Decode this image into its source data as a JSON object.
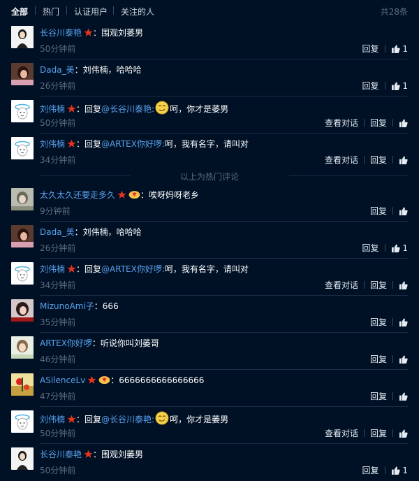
{
  "tabs": [
    {
      "label": "全部",
      "active": true
    },
    {
      "label": "热门",
      "active": false
    },
    {
      "label": "认证用户",
      "active": false
    },
    {
      "label": "关注的人",
      "active": false
    }
  ],
  "total": "共28条",
  "divider": "以上为热门评论",
  "comments": [
    {
      "name": "长谷川泰艳",
      "badge": "star",
      "pre": "：",
      "mention": "",
      "emoji": "",
      "body": "围观刘萎男",
      "time": "50分钟前",
      "reply": "回复",
      "dialog": "",
      "likes": "1",
      "avatar": "girl-white"
    },
    {
      "name": "Dada_美",
      "badge": "",
      "pre": "：",
      "mention": "",
      "emoji": "",
      "body": "刘伟楠，哈哈哈",
      "time": "26分钟前",
      "reply": "回复",
      "dialog": "",
      "likes": "1",
      "avatar": "girl-dark"
    },
    {
      "name": "刘伟楠",
      "badge": "star",
      "pre": "：回复",
      "mention": "@长谷川泰艳:",
      "emoji": "smile",
      "body": "呵，你才是萎男",
      "time": "50分钟前",
      "reply": "回复",
      "dialog": "查看对话",
      "likes": "",
      "avatar": "egg"
    },
    {
      "name": "刘伟楠",
      "badge": "star",
      "pre": "：回复",
      "mention": "@ARTEX你好啰:",
      "emoji": "",
      "body": "呵，我有名字，请叫对",
      "time": "34分钟前",
      "reply": "回复",
      "dialog": "查看对话",
      "likes": "",
      "avatar": "egg"
    },
    {
      "name": "太久太久还要走多久",
      "badge": "star2",
      "pre": "：",
      "mention": "",
      "emoji": "",
      "body": "唉呀妈呀老乡",
      "time": "9分钟前",
      "reply": "回复",
      "dialog": "",
      "likes": "",
      "avatar": "girl-gray"
    },
    {
      "name": "Dada_美",
      "badge": "",
      "pre": "：",
      "mention": "",
      "emoji": "",
      "body": "刘伟楠，哈哈哈",
      "time": "26分钟前",
      "reply": "回复",
      "dialog": "",
      "likes": "1",
      "avatar": "girl-dark"
    },
    {
      "name": "刘伟楠",
      "badge": "star",
      "pre": "：回复",
      "mention": "@ARTEX你好啰:",
      "emoji": "",
      "body": "呵，我有名字，请叫对",
      "time": "34分钟前",
      "reply": "回复",
      "dialog": "查看对话",
      "likes": "",
      "avatar": "egg"
    },
    {
      "name": "MizunoAmi子",
      "badge": "",
      "pre": "：",
      "mention": "",
      "emoji": "",
      "body": "666",
      "time": "35分钟前",
      "reply": "回复",
      "dialog": "",
      "likes": "",
      "avatar": "girl-pink"
    },
    {
      "name": "ARTEX你好啰",
      "badge": "",
      "pre": "：",
      "mention": "",
      "emoji": "",
      "body": "听说你叫刘萎哥",
      "time": "46分钟前",
      "reply": "回复",
      "dialog": "",
      "likes": "",
      "avatar": "girl-light"
    },
    {
      "name": "ASilenceLv",
      "badge": "star2",
      "pre": "：",
      "mention": "",
      "emoji": "",
      "body": "6666666666666666",
      "time": "47分钟前",
      "reply": "回复",
      "dialog": "",
      "likes": "",
      "avatar": "flower"
    },
    {
      "name": "刘伟楠",
      "badge": "star",
      "pre": "：回复",
      "mention": "@长谷川泰艳:",
      "emoji": "smile",
      "body": "呵，你才是萎男",
      "time": "50分钟前",
      "reply": "回复",
      "dialog": "查看对话",
      "likes": "",
      "avatar": "egg"
    },
    {
      "name": "长谷川泰艳",
      "badge": "star",
      "pre": "：",
      "mention": "",
      "emoji": "",
      "body": "围观刘萎男",
      "time": "50分钟前",
      "reply": "回复",
      "dialog": "",
      "likes": "1",
      "avatar": "girl-white"
    }
  ],
  "colors": {
    "background": "#001126",
    "link": "#5aa0ec",
    "muted": "#5e6b7c",
    "badge": "#e8341c"
  }
}
